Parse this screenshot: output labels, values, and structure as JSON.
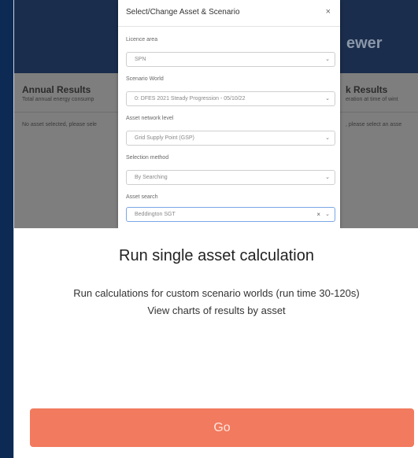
{
  "preview": {
    "title": "ewer",
    "left_title": "Annual Results",
    "left_subtitle": "Total annual energy consump",
    "left_message": "No asset selected, please sele",
    "right_title": "k Results",
    "right_subtitle": "eration at time of wint",
    "right_message": ", please select an asse"
  },
  "modal": {
    "title": "Select/Change Asset & Scenario",
    "close_glyph": "×",
    "fields": [
      {
        "label": "Licence area",
        "value": "SPN"
      },
      {
        "label": "Scenario World",
        "value": "0: DFES 2021 Steady Progression - 05/10/22"
      },
      {
        "label": "Asset network level",
        "value": "Grid Supply Point (GSP)"
      },
      {
        "label": "Selection method",
        "value": "By Searching"
      },
      {
        "label": "Asset search",
        "value": "Beddington SGT"
      }
    ],
    "clear_glyph": "×",
    "chevron_glyph": "⌄"
  },
  "main": {
    "title": "Run single asset calculation",
    "desc_line1": "Run calculations for custom scenario worlds (run time 30-120s)",
    "desc_line2": "View charts of results by asset"
  },
  "go_label": "Go",
  "colors": {
    "background": "#0d2a55",
    "go_button": "#f27a5e",
    "preview_header": "#1a2d4c"
  }
}
